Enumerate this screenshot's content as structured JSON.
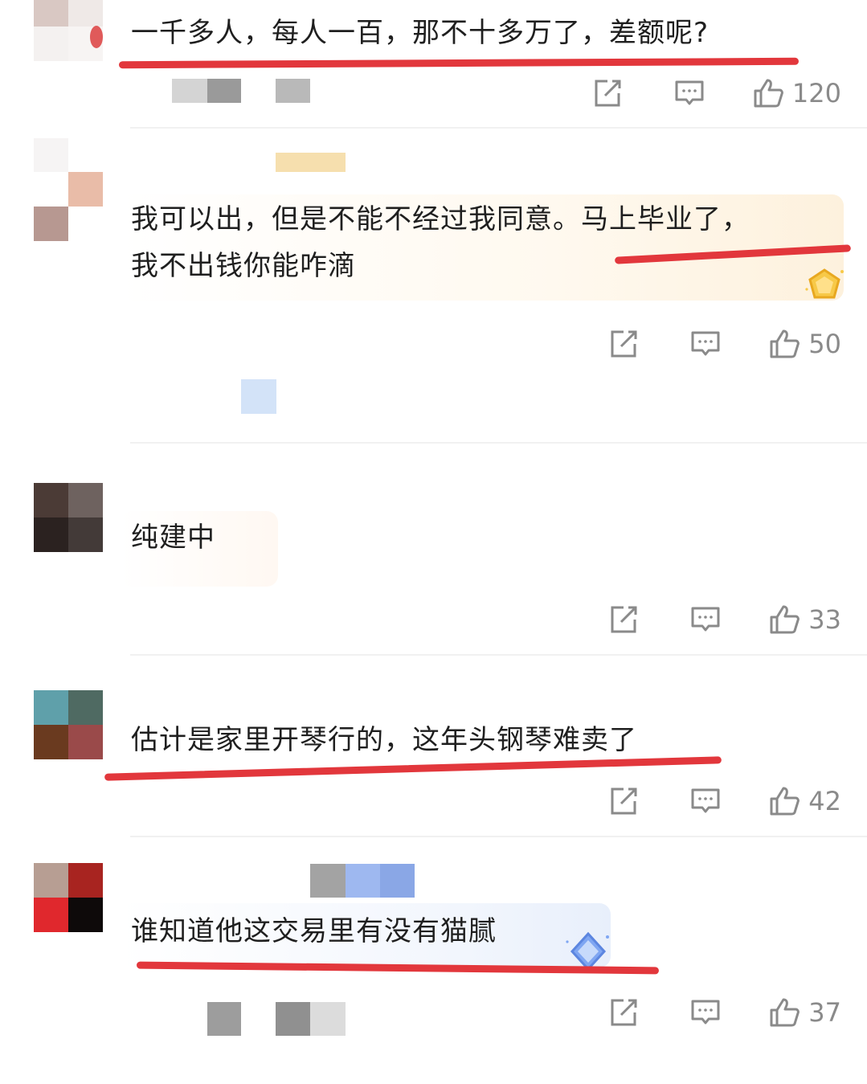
{
  "comments": [
    {
      "text": "一千多人，每人一百，那不十多万了，差额呢?",
      "likes": "120"
    },
    {
      "text_line1": "我可以出，但是不能不经过我同意。马上毕业了，",
      "text_line2": "我不出钱你能咋滴",
      "likes": "50"
    },
    {
      "text": "纯建中",
      "likes": "33"
    },
    {
      "text": "估计是家里开琴行的，这年头钢琴难卖了",
      "likes": "42"
    },
    {
      "text": "谁知道他这交易里有没有猫腻",
      "likes": "37"
    }
  ],
  "colors": {
    "underline": "#e2373c",
    "text": "#1f1f1f",
    "meta": "#8a8a8a"
  },
  "icons": [
    "share-icon",
    "reply-icon",
    "like-icon",
    "gold-badge-icon",
    "diamond-badge-icon"
  ]
}
